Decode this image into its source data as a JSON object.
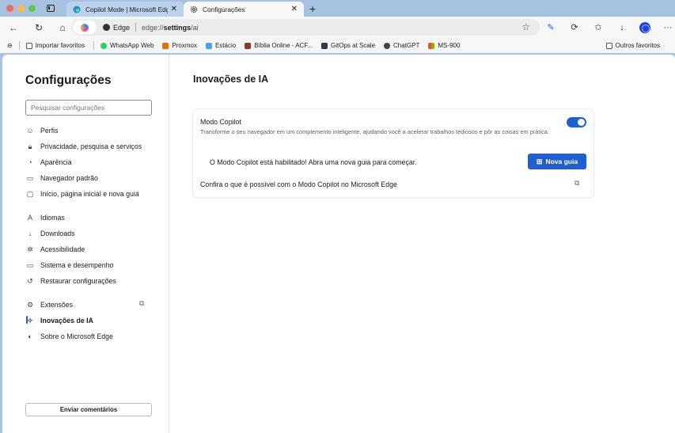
{
  "tabs": [
    {
      "title": "Copilot Mode | Microsoft Edge",
      "active": false
    },
    {
      "title": "Configurações",
      "active": true
    }
  ],
  "address_bar": {
    "site_label": "Edge",
    "url_prefix": "edge://",
    "url_bold": "settings",
    "url_suffix": "/ai"
  },
  "favorites": [
    {
      "label": "Importar favoritos",
      "color": "#555555"
    },
    {
      "label": "WhatsApp Web",
      "color": "#25d366"
    },
    {
      "label": "Proxmox",
      "color": "#e57000"
    },
    {
      "label": "Estácio",
      "color": "#4aa3df"
    },
    {
      "label": "Bíblia Online - ACF...",
      "color": "#8b3a2a"
    },
    {
      "label": "GitOps at Scale",
      "color": "#2d3a4a"
    },
    {
      "label": "ChatGPT",
      "color": "#444444"
    },
    {
      "label": "MS-900",
      "color": "#f25022"
    }
  ],
  "favorites_other": "Outros favoritos",
  "sidebar": {
    "title": "Configurações",
    "search_placeholder": "Pesquisar configurações",
    "items": [
      {
        "label": "Perfis",
        "icon": "profile-icon"
      },
      {
        "label": "Privacidade, pesquisa e serviços",
        "icon": "lock-icon"
      },
      {
        "label": "Aparência",
        "icon": "appearance-icon"
      },
      {
        "label": "Navegador padrão",
        "icon": "browser-icon"
      },
      {
        "label": "Início, página inicial e nova guia",
        "icon": "home-icon"
      },
      {
        "label": "Idiomas",
        "icon": "language-icon"
      },
      {
        "label": "Downloads",
        "icon": "download-icon"
      },
      {
        "label": "Acessibilidade",
        "icon": "accessibility-icon"
      },
      {
        "label": "Sistema e desempenho",
        "icon": "laptop-icon"
      },
      {
        "label": "Restaurar configurações",
        "icon": "reset-icon"
      },
      {
        "label": "Extensões",
        "icon": "extensions-icon"
      },
      {
        "label": "Inovações de IA",
        "icon": "ai-icon",
        "active": true
      },
      {
        "label": "Sobre o Microsoft Edge",
        "icon": "edge-icon"
      }
    ],
    "feedback": "Enviar comentários"
  },
  "main": {
    "title": "Inovações de IA",
    "copilot": {
      "title": "Modo Copilot",
      "description": "Transforme o seu navegador em um complemento inteligente, ajudando você a acelerar trabalhos tediosos e pôr as coisas em prática.",
      "enabled": true,
      "enabled_message": "O Modo Copilot está habilitado! Abra uma nova guia para começar.",
      "new_tab_button": "Nova guia",
      "learn_more": "Confira o que é possível com o Modo Copilot no Microsoft Edge"
    }
  },
  "colors": {
    "accent": "#1f5fcf",
    "frame": "#a7c1e1"
  }
}
